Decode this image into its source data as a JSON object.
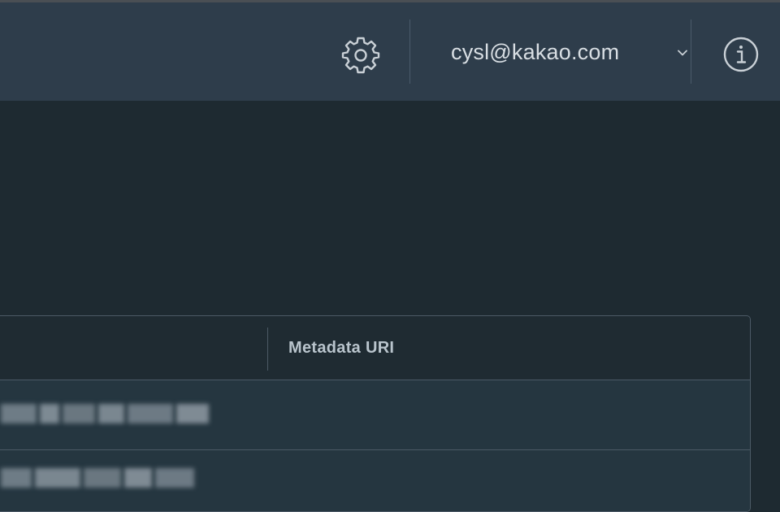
{
  "header": {
    "settings_icon": "gear-icon",
    "user_email": "cysl@kakao.com",
    "user_menu_icon": "chevron-down-icon",
    "info_icon": "info-circle-icon"
  },
  "table": {
    "columns": [
      "Metadata URI"
    ]
  },
  "colors": {
    "header_bg": "#2e3d4b",
    "page_bg": "#1e2a31",
    "table_row_bg": "#253640",
    "border": "#4c5a66",
    "text_light": "#d8dee3"
  }
}
